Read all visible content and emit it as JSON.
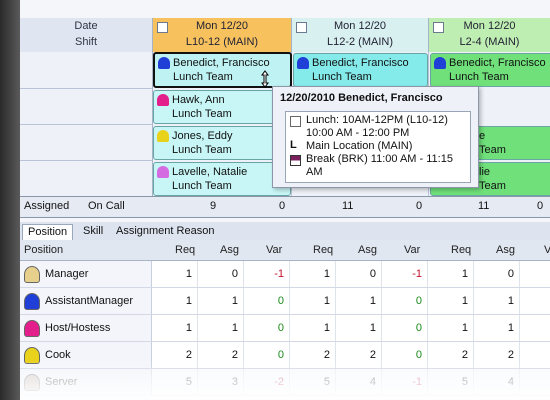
{
  "header": {
    "left_line1": "Date",
    "left_line2": "Shift",
    "days": [
      {
        "date": "Mon 12/20",
        "shift": "L10-12 (MAIN)",
        "color": "#f7c25e",
        "selected": true
      },
      {
        "date": "Mon 12/20",
        "shift": "L12-2 (MAIN)",
        "color": "#d9f0f0",
        "selected": false
      },
      {
        "date": "Mon 12/20",
        "shift": "L2-4 (MAIN)",
        "color": "#bfeeb2",
        "selected": false
      }
    ]
  },
  "columns": [
    {
      "cards": [
        {
          "name": "Benedict, Francisco",
          "team": "Lunch Team",
          "avatar": "#1f3fd6",
          "bg": "#bff3f3",
          "selected": true
        },
        {
          "name": "Hawk, Ann",
          "team": "Lunch Team",
          "avatar": "#e21f8b",
          "bg": "#c8f6f6"
        },
        {
          "name": "Jones, Eddy",
          "team": "Lunch Team",
          "avatar": "#e8d21b",
          "bg": "#c8f6f6"
        },
        {
          "name": "Lavelle, Natalie",
          "team": "Lunch Team",
          "avatar": "#d46be0",
          "bg": "#c8f6f6"
        }
      ]
    },
    {
      "cards": [
        {
          "name": "Benedict, Francisco",
          "team": "Lunch Team",
          "avatar": "#1f3fd6",
          "bg": "#84eaea"
        }
      ]
    },
    {
      "cards": [
        {
          "name": "Benedict, Francisco",
          "team": "Lunch Team",
          "avatar": "#1f3fd6",
          "bg": "#6fe07a"
        },
        {
          "name": "e",
          "team": "Team",
          "avatar": "",
          "bg": "#6fe07a"
        },
        {
          "name": "lie",
          "team": "Team",
          "avatar": "",
          "bg": "#6fe07a"
        }
      ]
    }
  ],
  "assigned": {
    "label": "Assigned",
    "oncall": "On Call",
    "values": [
      "9",
      "0",
      "11",
      "0",
      "11",
      "0"
    ]
  },
  "tabs": [
    "Position",
    "Skill",
    "Assignment Reason"
  ],
  "grid": {
    "col_position": "Position",
    "headers": [
      "Req",
      "Asg",
      "Var",
      "Req",
      "Asg",
      "Var",
      "Req",
      "Asg",
      "V"
    ],
    "rows": [
      {
        "label": "Manager",
        "avatar": "#e7cf8c",
        "values": [
          "1",
          "0",
          "-1",
          "1",
          "0",
          "-1",
          "1",
          "0",
          ""
        ]
      },
      {
        "label": "AssistantManager",
        "avatar": "#1f3fd6",
        "values": [
          "1",
          "1",
          "0",
          "1",
          "1",
          "0",
          "1",
          "1",
          ""
        ]
      },
      {
        "label": "Host/Hostess",
        "avatar": "#e21f8b",
        "values": [
          "1",
          "1",
          "0",
          "1",
          "1",
          "0",
          "1",
          "1",
          ""
        ]
      },
      {
        "label": "Cook",
        "avatar": "#e8d21b",
        "values": [
          "2",
          "2",
          "0",
          "2",
          "2",
          "0",
          "2",
          "2",
          ""
        ]
      },
      {
        "label": "Server",
        "avatar": "#c9b6b0",
        "values": [
          "5",
          "3",
          "-2",
          "5",
          "4",
          "-1",
          "5",
          "4",
          ""
        ]
      }
    ]
  },
  "tooltip": {
    "title": "12/20/2010 Benedict, Francisco",
    "line1": "Lunch: 10AM-12PM (L10-12)",
    "line2": "10:00 AM - 12:00 PM",
    "line3": "Main Location (MAIN)",
    "line4": "Break (BRK) 11:00 AM - 11:15",
    "line5": "AM",
    "icon3": "L"
  }
}
